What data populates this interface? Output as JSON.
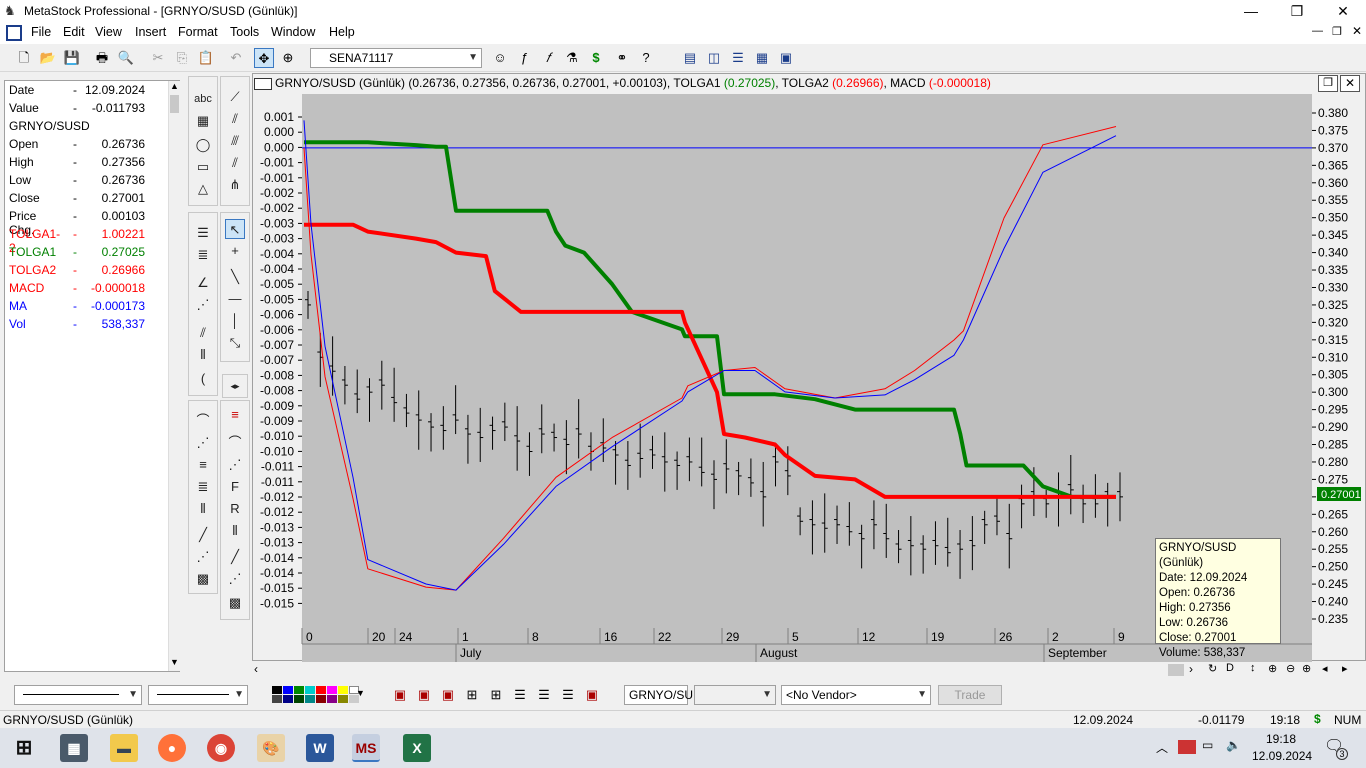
{
  "window": {
    "title": "MetaStock Professional - [GRNYO/SUSD (Günlük)]",
    "controls": [
      "—",
      "❐",
      "✕"
    ]
  },
  "menu": [
    "File",
    "Edit",
    "View",
    "Insert",
    "Format",
    "Tools",
    "Window",
    "Help"
  ],
  "toolbar": {
    "security_combo": "SENA71117"
  },
  "data_window": {
    "rows": [
      {
        "name": "Date",
        "value": "12.09.2024",
        "color": "#000000"
      },
      {
        "name": "Value",
        "value": "-0.011793",
        "color": "#000000"
      },
      {
        "name": "GRNYO/SUSD",
        "value": "",
        "color": "#000000",
        "header": true
      },
      {
        "name": "Open",
        "value": "0.26736",
        "color": "#000000"
      },
      {
        "name": "High",
        "value": "0.27356",
        "color": "#000000"
      },
      {
        "name": "Low",
        "value": "0.26736",
        "color": "#000000"
      },
      {
        "name": "Close",
        "value": "0.27001",
        "color": "#000000"
      },
      {
        "name": "Price Chg.",
        "value": "0.00103",
        "color": "#000000"
      },
      {
        "name": "TOLGA1-2",
        "value": "1.00221",
        "color": "#ff0000"
      },
      {
        "name": "TOLGA1",
        "value": "0.27025",
        "color": "#008000"
      },
      {
        "name": "TOLGA2",
        "value": "0.26966",
        "color": "#ff0000"
      },
      {
        "name": "MACD",
        "value": "-0.000018",
        "color": "#ff0000"
      },
      {
        "name": "MA",
        "value": "-0.000173",
        "color": "#0000ff"
      },
      {
        "name": "Vol",
        "value": "538,337",
        "color": "#0000ff"
      }
    ]
  },
  "chart_window": {
    "title_prefix": "GRNYO/SUSD (Günlük) (0.26736, 0.27356, 0.26736, 0.27001, +0.00103), TOLGA1 ",
    "tolga1_val": "(0.27025)",
    "tolga2_label": ", TOLGA2 ",
    "tolga2_val": "(0.26966)",
    "macd_label": ", MACD ",
    "macd_val": "(-0.000018)",
    "last_price_badge": "0.27001"
  },
  "tooltip": {
    "lines": [
      "GRNYO/SUSD (Günlük)",
      "Date: 12.09.2024",
      "Open: 0.26736",
      "High: 0.27356",
      "Low: 0.26736",
      "Close: 0.27001",
      "Volume: 538,337"
    ]
  },
  "chart_data": {
    "type": "line",
    "left_axis_ticks": [
      "0.001",
      "0.000",
      "0.000",
      "-0.001",
      "-0.001",
      "-0.002",
      "-0.002",
      "-0.003",
      "-0.003",
      "-0.004",
      "-0.004",
      "-0.005",
      "-0.005",
      "-0.006",
      "-0.006",
      "-0.007",
      "-0.007",
      "-0.008",
      "-0.008",
      "-0.009",
      "-0.009",
      "-0.010",
      "-0.010",
      "-0.011",
      "-0.011",
      "-0.012",
      "-0.012",
      "-0.013",
      "-0.013",
      "-0.014",
      "-0.014",
      "-0.015",
      "-0.015"
    ],
    "right_axis_ticks": [
      "0.380",
      "0.375",
      "0.370",
      "0.365",
      "0.360",
      "0.355",
      "0.350",
      "0.345",
      "0.340",
      "0.335",
      "0.330",
      "0.325",
      "0.320",
      "0.315",
      "0.310",
      "0.305",
      "0.300",
      "0.295",
      "0.290",
      "0.285",
      "0.280",
      "0.275",
      "0.270",
      "0.265",
      "0.260",
      "0.255",
      "0.250",
      "0.245",
      "0.240",
      "0.235"
    ],
    "right_ylim": [
      0.235,
      0.38
    ],
    "x_day_labels": [
      "0",
      "20",
      "24",
      "1",
      "8",
      "16",
      "22",
      "29",
      "5",
      "12",
      "19",
      "26",
      "2",
      "9"
    ],
    "x_month_labels": [
      "July",
      "August",
      "September"
    ],
    "zero_line": 0.37,
    "series": [
      {
        "name": "TOLGA1",
        "color": "#008000",
        "x": [
          "06-17",
          "06-24",
          "06-28",
          "07-01",
          "07-03",
          "07-04",
          "07-05",
          "07-08",
          "07-12",
          "07-15",
          "07-16",
          "07-17",
          "07-19",
          "07-22",
          "07-24",
          "07-25",
          "07-29",
          "07-30",
          "08-01",
          "08-02",
          "08-08",
          "08-12",
          "08-16",
          "08-19",
          "08-23",
          "08-26",
          "08-28",
          "08-30",
          "09-04",
          "09-06",
          "09-09",
          "09-12"
        ],
        "values": [
          0.3716,
          0.3716,
          0.3716,
          0.3708,
          0.3703,
          0.3703,
          0.352,
          0.352,
          0.352,
          0.352,
          0.346,
          0.342,
          0.34,
          0.331,
          0.323,
          0.322,
          0.318,
          0.316,
          0.316,
          0.2994,
          0.2994,
          0.298,
          0.295,
          0.295,
          0.295,
          0.295,
          0.288,
          0.279,
          0.279,
          0.273,
          0.27,
          0.27
        ]
      },
      {
        "name": "TOLGA2",
        "color": "#ff0000",
        "x": [
          "06-17",
          "06-24",
          "06-28",
          "07-01",
          "07-03",
          "07-05",
          "07-08",
          "07-09",
          "07-12",
          "07-29",
          "07-30",
          "08-01",
          "08-02",
          "08-05",
          "08-08",
          "08-09",
          "08-12",
          "08-16",
          "08-19",
          "09-12"
        ],
        "values": [
          0.348,
          0.348,
          0.346,
          0.344,
          0.343,
          0.34,
          0.339,
          0.329,
          0.323,
          0.323,
          0.32,
          0.3,
          0.288,
          0.287,
          0.285,
          0.282,
          0.276,
          0.275,
          0.27,
          0.27
        ]
      },
      {
        "name": "MACD",
        "color": "#ff0000",
        "x": [
          "06-17",
          "06-18",
          "06-20",
          "06-24",
          "06-28",
          "07-02",
          "07-05",
          "07-10",
          "07-16",
          "07-22",
          "07-29",
          "07-31",
          "08-02",
          "08-06",
          "08-09",
          "08-14",
          "08-19",
          "08-22",
          "08-26",
          "08-29",
          "09-02",
          "09-06",
          "09-12"
        ],
        "values": [
          0.0,
          -0.0035,
          -0.0075,
          -0.0115,
          -0.0138,
          -0.0144,
          -0.0145,
          -0.0128,
          -0.0108,
          -0.0095,
          -0.0082,
          -0.0078,
          -0.0073,
          -0.0072,
          -0.0079,
          -0.0082,
          -0.0079,
          -0.0073,
          -0.0063,
          -0.006,
          -0.0023,
          0.0001,
          0.0007
        ]
      },
      {
        "name": "MA",
        "color": "#0000ff",
        "x": [
          "06-17",
          "06-18",
          "06-20",
          "06-24",
          "06-28",
          "07-02",
          "07-05",
          "07-10",
          "07-16",
          "07-22",
          "07-29",
          "07-31",
          "08-02",
          "08-06",
          "08-09",
          "08-14",
          "08-19",
          "08-22",
          "08-26",
          "08-29",
          "09-02",
          "09-06",
          "09-12"
        ],
        "values": [
          0.0009,
          -0.0025,
          -0.0065,
          -0.0108,
          -0.0135,
          -0.0143,
          -0.0145,
          -0.013,
          -0.0111,
          -0.0098,
          -0.0083,
          -0.008,
          -0.0073,
          -0.0073,
          -0.008,
          -0.0082,
          -0.0081,
          -0.0076,
          -0.0068,
          -0.0063,
          -0.0033,
          -0.0008,
          0.0004
        ]
      }
    ]
  },
  "bottom": {
    "security_field": "GRNYO/SU",
    "vendor_combo": "<No Vendor>",
    "trade_button": "Trade"
  },
  "status": {
    "left": "GRNYO/SUSD (Günlük)",
    "date": "12.09.2024",
    "value": "-0.01179",
    "time": "19:18",
    "dollar": "$",
    "num": "NUM"
  },
  "taskbar": {
    "time": "19:18",
    "date": "12.09.2024",
    "notif_count": "3"
  },
  "colors": {
    "chart_bg": "#c0c0c0",
    "bars": "#000000",
    "zero_line": "#0000ff",
    "badge_bg": "#008000"
  }
}
